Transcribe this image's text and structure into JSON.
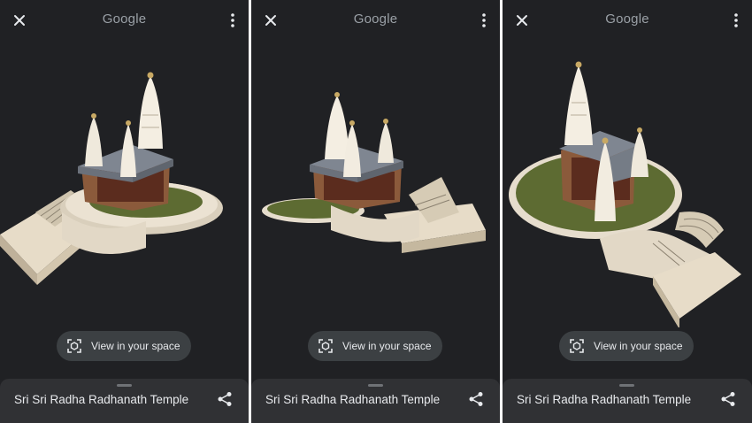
{
  "screens": [
    {
      "logo": "Google",
      "close_icon": "close-icon",
      "menu_icon": "more-vert-icon",
      "ar_button": {
        "label": "View in your space",
        "icon": "ar-view-icon"
      },
      "bottom_sheet": {
        "title": "Sri Sri Radha Radhanath Temple",
        "share_icon": "share-icon"
      }
    },
    {
      "logo": "Google",
      "close_icon": "close-icon",
      "menu_icon": "more-vert-icon",
      "ar_button": {
        "label": "View in your space",
        "icon": "ar-view-icon"
      },
      "bottom_sheet": {
        "title": "Sri Sri Radha Radhanath Temple",
        "share_icon": "share-icon"
      }
    },
    {
      "logo": "Google",
      "close_icon": "close-icon",
      "menu_icon": "more-vert-icon",
      "ar_button": {
        "label": "View in your space",
        "icon": "ar-view-icon"
      },
      "bottom_sheet": {
        "title": "Sri Sri Radha Radhanath Temple",
        "share_icon": "share-icon"
      }
    }
  ],
  "colors": {
    "background": "#202124",
    "sheet": "#303134",
    "button": "#3c4043",
    "text": "#e8eaed",
    "logo": "#9aa0a6"
  }
}
